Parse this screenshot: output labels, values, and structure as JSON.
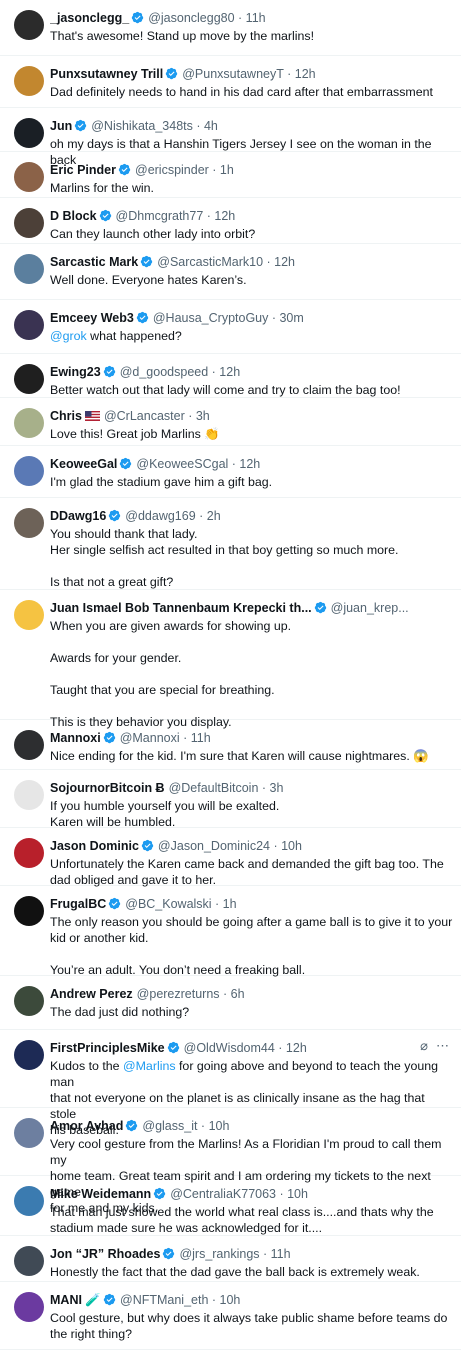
{
  "replies": [
    {
      "name": "_jasonclegg_",
      "handle": "@jasonclegg80",
      "time": "11h",
      "color": "#2b2b2b",
      "lines": [
        "That's awesome! Stand up move by the marlins!"
      ]
    },
    {
      "name": "Punxsutawney Trill",
      "handle": "@PunxsutawneyT",
      "time": "12h",
      "color": "#c2872f",
      "lines": [
        "Dad definitely needs to hand in his dad card after that embarrassment"
      ]
    },
    {
      "name": "Jun",
      "handle": "@Nishikata_348ts",
      "time": "4h",
      "color": "#1a1f25",
      "lines": [
        "oh my days is that a Hanshin Tigers Jersey I see on the woman in the back"
      ]
    },
    {
      "name": "Eric Pinder",
      "handle": "@ericspinder",
      "time": "1h",
      "color": "#8b6248",
      "lines": [
        "Marlins for the win."
      ]
    },
    {
      "name": "D Block",
      "handle": "@Dhmcgrath77",
      "time": "12h",
      "color": "#4c4038",
      "lines": [
        "Can they launch other lady into orbit?"
      ]
    },
    {
      "name": "Sarcastic Mark",
      "handle": "@SarcasticMark10",
      "time": "12h",
      "color": "#5b7f9e",
      "lines": [
        "Well done.  Everyone hates Karen’s."
      ]
    },
    {
      "name": "Emceey Web3",
      "handle": "@Hausa_CryptoGuy",
      "time": "30m",
      "color": "#3a3352",
      "mention": "@grok",
      "lines": [
        " what happened?"
      ]
    },
    {
      "name": "Ewing23",
      "handle": "@d_goodspeed",
      "time": "12h",
      "color": "#1f1f1f",
      "lines": [
        "Better watch out that lady will come and try to claim the bag too!"
      ]
    },
    {
      "name": "Chris",
      "handle": "@CrLancaster",
      "time": "3h",
      "color": "#a7b08a",
      "flag": "us",
      "noverified": true,
      "lines": [
        "Love this! Great job Marlins 👏"
      ]
    },
    {
      "name": "KeoweeGal",
      "handle": "@KeoweeSCgal",
      "time": "12h",
      "color": "#5a79b5",
      "lines": [
        "I'm glad the stadium gave him a gift bag."
      ]
    },
    {
      "name": "DDawg16",
      "handle": "@ddawg169",
      "time": "2h",
      "color": "#6d6258",
      "paras": [
        [
          "You should thank that lady.",
          "Her single selfish act resulted in that boy getting so much more."
        ],
        [
          "Is that not a great gift?"
        ]
      ]
    },
    {
      "name": "Juan Ismael Bob Tannenbaum Krepecki th...",
      "handle": "@juan_krep...",
      "time": "",
      "color": "#f5c342",
      "paras": [
        [
          "When you are given awards for showing up."
        ],
        [
          "Awards for your gender."
        ],
        [
          "Taught that you are special for breathing."
        ],
        [
          "This is they behavior you display."
        ]
      ]
    },
    {
      "name": "Mannoxi",
      "handle": "@Mannoxi",
      "time": "11h",
      "color": "#2d2e30",
      "lines": [
        "Nice ending for the kid. I'm sure that Karen will cause nightmares. 😱"
      ]
    },
    {
      "name": "SojournorBitcoin Ƀ",
      "handle": "@DefaultBitcoin",
      "time": "3h",
      "color": "#e6e6e6",
      "noverified": true,
      "lines": [
        "If you humble yourself you will be exalted.",
        "Karen will be humbled."
      ]
    },
    {
      "name": "Jason Dominic",
      "handle": "@Jason_Dominic24",
      "time": "10h",
      "color": "#b8202b",
      "lines": [
        "Unfortunately the Karen came back and demanded the gift bag too. The",
        "dad obliged and gave it to her."
      ]
    },
    {
      "name": "FrugalBC",
      "handle": "@BC_Kowalski",
      "time": "1h",
      "color": "#111111",
      "paras": [
        [
          "The only reason you should be going after a game ball is to give it to your",
          "kid or another kid."
        ],
        [
          "You’re an adult. You don’t need a freaking ball."
        ]
      ]
    },
    {
      "name": "Andrew Perez",
      "handle": "@perezreturns",
      "time": "6h",
      "color": "#3c4a3b",
      "noverified": true,
      "lines": [
        "The dad just did nothing?"
      ]
    },
    {
      "name": "FirstPrinciplesMike",
      "handle": "@OldWisdom44",
      "time": "12h",
      "color": "#1d2a55",
      "grok": true,
      "pre": "Kudos to the ",
      "mention": "@Marlins",
      "lines": [
        " for going above and beyond to teach the young man",
        "that not everyone on the planet is as clinically insane as the hag that stole",
        "his baseball."
      ]
    },
    {
      "name": "Amor Avhad",
      "handle": "@glass_it",
      "time": "10h",
      "color": "#6d7fa0",
      "lines": [
        "Very cool gesture from the Marlins! As a Floridian I'm proud to call them my",
        "home team. Great team spirit and I am ordering my tickets to the next game",
        "for me and my kids."
      ]
    },
    {
      "name": "Mike Weidemann",
      "handle": "@CentraliaK77063",
      "time": "10h",
      "color": "#3b7bb0",
      "lines": [
        "That man just showed the world what real class is....and thats why the",
        "stadium made sure he was acknowledged for it...."
      ]
    },
    {
      "name": "Jon “JR” Rhoades",
      "handle": "@jrs_rankings",
      "time": "11h",
      "color": "#404a55",
      "lines": [
        "Honestly the fact that the dad gave the ball back is extremely weak."
      ]
    },
    {
      "name": "MANI",
      "handle": "@NFTMani_eth",
      "time": "10h",
      "color": "#6b3aa0",
      "emoji": "🧪",
      "lines": [
        "Cool gesture, but why does it always take public shame before teams do",
        "the right thing?"
      ]
    }
  ]
}
